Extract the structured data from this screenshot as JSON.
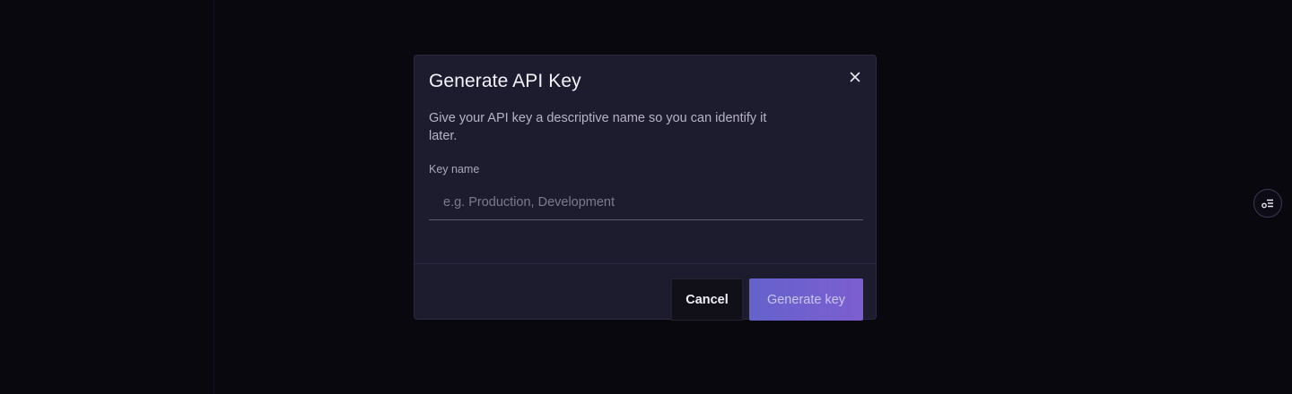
{
  "modal": {
    "title": "Generate API Key",
    "description": "Give your API key a descriptive name so you can identify it later.",
    "field_label": "Key name",
    "input": {
      "value": "",
      "placeholder": "e.g. Production, Development"
    },
    "close_icon": "close-icon",
    "buttons": {
      "cancel_label": "Cancel",
      "generate_label": "Generate key"
    }
  },
  "side_button": {
    "icon": "toggle-list-icon"
  },
  "colors": {
    "background": "#09080f",
    "modal_bg": "#1d1c2e",
    "primary_gradient_start": "#6462cc",
    "primary_gradient_end": "#7d5ed0"
  }
}
